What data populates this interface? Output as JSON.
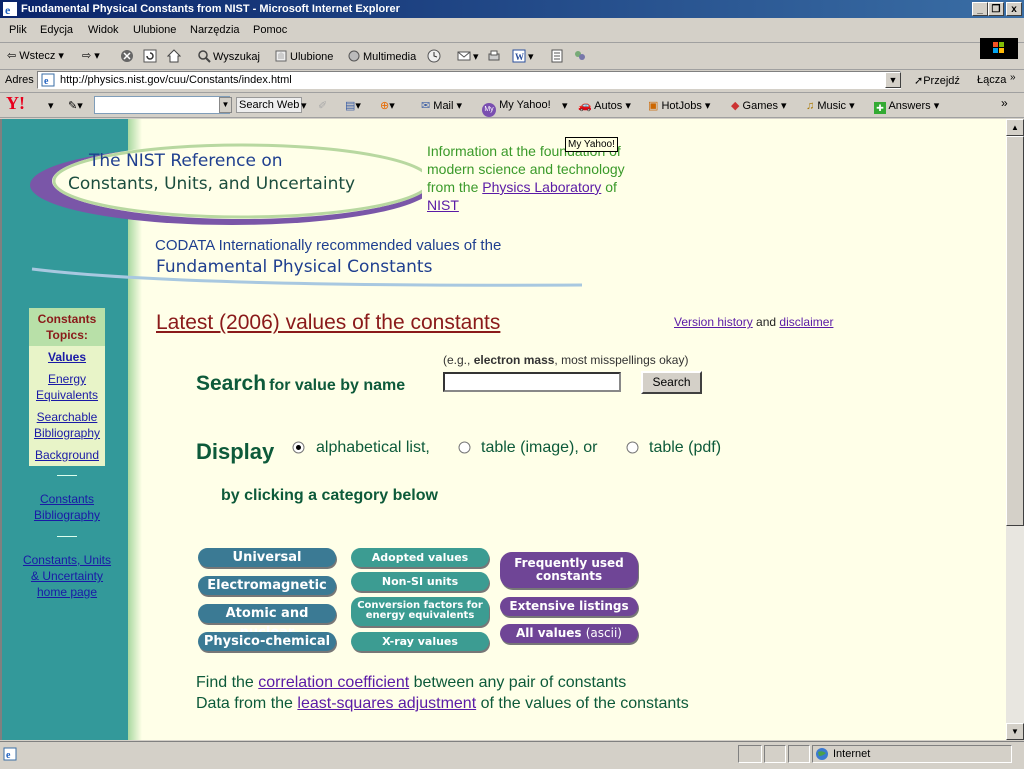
{
  "window": {
    "title": "Fundamental Physical Constants from NIST - Microsoft Internet Explorer",
    "min_label": "_",
    "max_label": "❐",
    "close_label": "x"
  },
  "menu": {
    "items": [
      "Plik",
      "Edycja",
      "Widok",
      "Ulubione",
      "Narzędzia",
      "Pomoc"
    ]
  },
  "toolbar": {
    "back": "Wstecz",
    "search": "Wyszukaj",
    "favorites": "Ulubione",
    "multimedia": "Multimedia"
  },
  "address": {
    "label": "Adres",
    "url": "http://physics.nist.gov/cuu/Constants/index.html",
    "go": "Przejdź",
    "links": "Łącza"
  },
  "yahoo": {
    "logo": "Y!",
    "search_web": "Search Web",
    "mail": "Mail",
    "my_yahoo": "My Yahoo!",
    "autos": "Autos",
    "hotjobs": "HotJobs",
    "games": "Games",
    "music": "Music",
    "answers": "Answers",
    "tooltip": "My Yahoo!"
  },
  "page": {
    "banner_line1": "The NIST Reference on",
    "banner_line2": "Constants, Units, and Uncertainty",
    "info_text": "Information at the foundation of modern science and technology from the",
    "info_link1": "Physics Laboratory",
    "info_of": "of",
    "info_link2": "NIST",
    "codata_line": "CODATA Internationally recommended values of the",
    "fundamental_line": "Fundamental Physical Constants",
    "sidebar": {
      "topics_title": "Constants Topics:",
      "values": "Values",
      "energy": "Energy Equivalents",
      "biblio": "Searchable Bibliography",
      "background": "Background",
      "constants_biblio": "Constants Bibliography",
      "home": "Constants, Units & Uncertainty home page"
    },
    "latest_title": "Latest (2006) values of the constants",
    "version_history": "Version history",
    "and": "and",
    "disclaimer": "disclaimer",
    "search_hint_pre": "(e.g.,",
    "search_hint_bold": "electron mass",
    "search_hint_post": ", most misspellings okay)",
    "search_big": "Search",
    "search_small": "for value by name",
    "search_button": "Search",
    "display_label": "Display",
    "option1": "alphabetical list,",
    "option2": "table (image), or",
    "option3": "table (pdf)",
    "by_clicking": "by clicking a category below",
    "categories_left": [
      "Universal",
      "Electromagnetic",
      "Atomic and nuclear",
      "Physico-chemical"
    ],
    "categories_mid": [
      "Adopted values",
      "Non-SI units",
      "Conversion factors for energy equivalents",
      "X-ray values"
    ],
    "frequently_used": "Frequently used constants",
    "extensive": "Extensive listings",
    "all_values": "All values",
    "ascii": "(ascii)",
    "find_pre": "Find the",
    "correlation": "correlation coefficient",
    "find_post": "between any pair of constants",
    "data_pre": "Data from the",
    "lsa": "least-squares adjustment",
    "data_post": "of the values of the constants"
  },
  "status": {
    "zone": "Internet"
  }
}
